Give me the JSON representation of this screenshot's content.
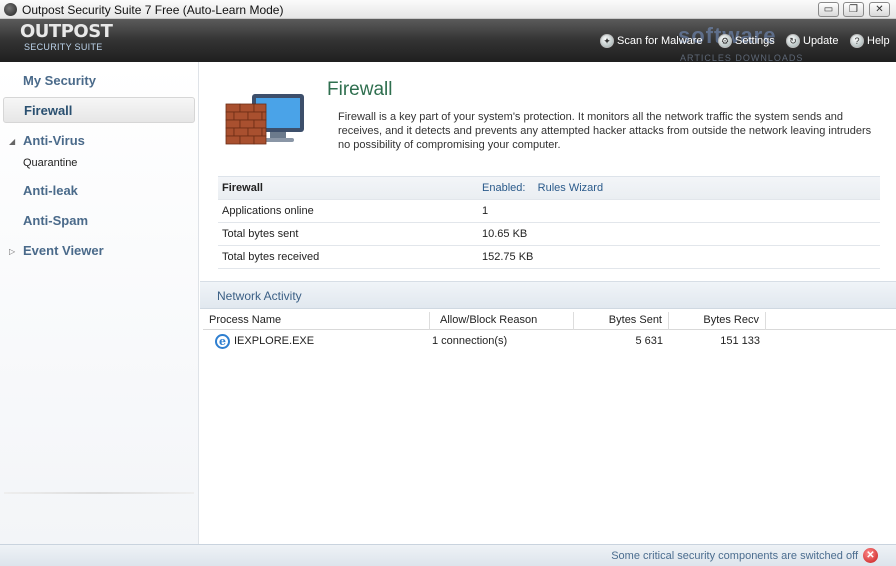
{
  "window": {
    "title": "Outpost Security Suite 7 Free (Auto-Learn Mode)",
    "controls": {
      "minimize": "▭",
      "maximize": "❐",
      "close": "✕"
    }
  },
  "header": {
    "logo_line1": "OUTPOST",
    "logo_line2": "SECURITY SUITE",
    "watermark": "software",
    "watermark_sub": "ARTICLES DOWNLOADS",
    "actions": [
      {
        "label": "Scan for Malware",
        "icon": "scan-icon"
      },
      {
        "label": "Settings",
        "icon": "settings-icon"
      },
      {
        "label": "Update",
        "icon": "update-icon"
      },
      {
        "label": "Help",
        "icon": "help-icon"
      }
    ]
  },
  "sidebar": {
    "items": [
      {
        "label": "My Security"
      },
      {
        "label": "Firewall",
        "active": true
      },
      {
        "label": "Anti-Virus",
        "expanded": true
      },
      {
        "label": "Quarantine",
        "sub": true
      },
      {
        "label": "Anti-leak"
      },
      {
        "label": "Anti-Spam"
      },
      {
        "label": "Event Viewer",
        "expanded": false
      }
    ]
  },
  "main": {
    "title": "Firewall",
    "description": "Firewall is a key part of your system's protection. It monitors all the network traffic the system sends and receives, and it detects and prevents any attempted hacker attacks from outside the network leaving intruders no possibility of compromising your computer.",
    "stats": {
      "firewall_label": "Firewall",
      "firewall_status": "Enabled:",
      "firewall_link": "Rules Wizard",
      "rows": [
        {
          "key": "Applications online",
          "value": "1"
        },
        {
          "key": "Total bytes sent",
          "value": "10.65 KB"
        },
        {
          "key": "Total bytes received",
          "value": "152.75 KB"
        }
      ]
    },
    "network_activity": {
      "title": "Network Activity",
      "columns": [
        "Process Name",
        "Allow/Block Reason",
        "Bytes Sent",
        "Bytes Recv"
      ],
      "rows": [
        {
          "process": "IEXPLORE.EXE",
          "reason": "1 connection(s)",
          "sent": "5 631",
          "recv": "151 133"
        }
      ]
    }
  },
  "statusbar": {
    "message": "Some critical security components are switched off",
    "colors": {
      "accent": "#4b6d8f",
      "warning": "#c41a1a"
    }
  }
}
